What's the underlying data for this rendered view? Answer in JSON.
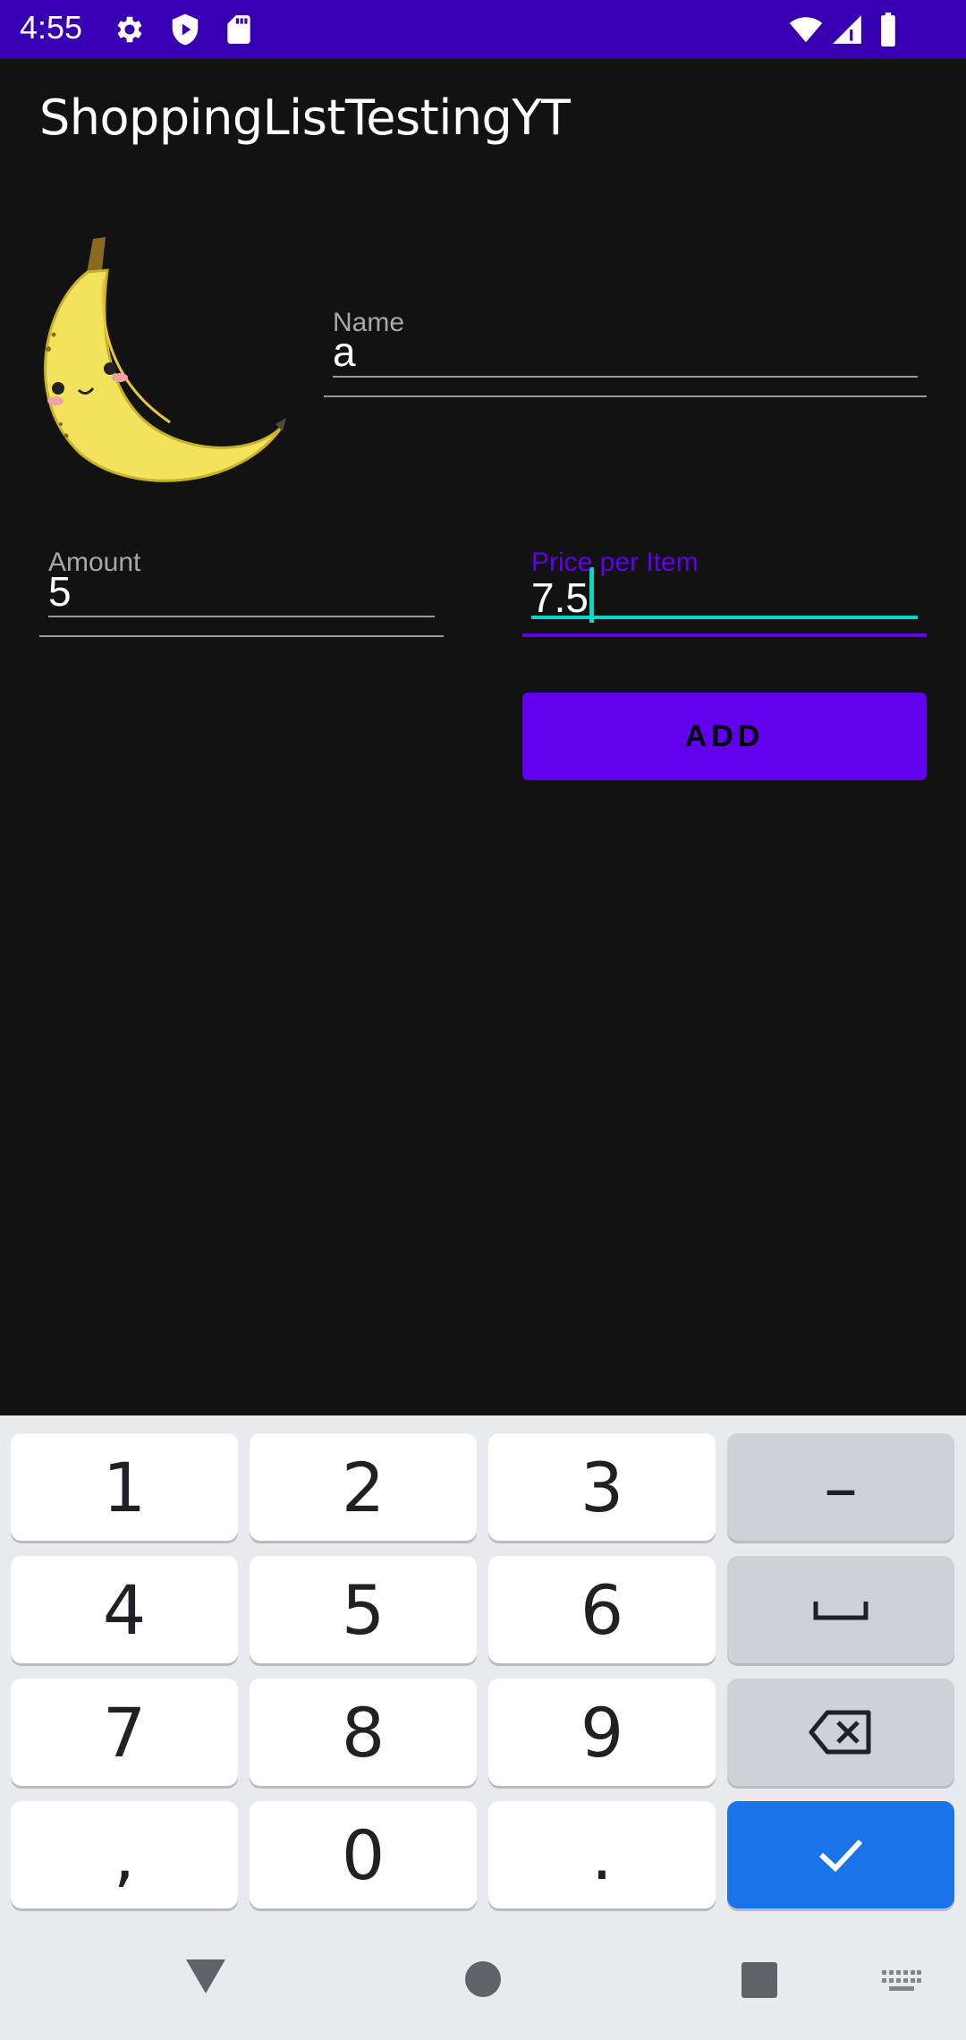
{
  "status_bar": {
    "time": "4:55",
    "left_icons": [
      "gear-icon",
      "shield-icon",
      "sd-card-icon"
    ],
    "right_icons": [
      "wifi-icon",
      "cell-signal-icon",
      "battery-icon"
    ],
    "background": "#3700b3"
  },
  "app": {
    "title": "ShoppingListTestingYT"
  },
  "form": {
    "name": {
      "label": "Name",
      "value": "a"
    },
    "amount": {
      "label": "Amount",
      "value": "5"
    },
    "price": {
      "label": "Price per Item",
      "value": "7.5"
    },
    "add_label": "ADD"
  },
  "keyboard": {
    "keys": [
      "1",
      "2",
      "3",
      "–",
      "4",
      "5",
      "6",
      "␣",
      "7",
      "8",
      "9",
      "backspace",
      ",",
      "0",
      ".",
      "done"
    ]
  },
  "colors": {
    "primary": "#6200ee",
    "primary_dark": "#3700b3",
    "accent": "#03dac5",
    "background": "#121212",
    "key_done": "#1a73e8"
  }
}
